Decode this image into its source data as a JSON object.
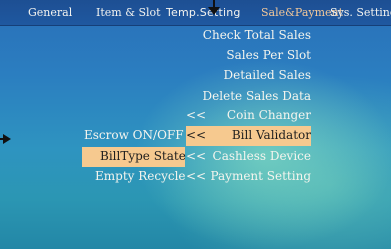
{
  "tabs": [
    {
      "label": "General"
    },
    {
      "label": "Item & Slot"
    },
    {
      "label": "Temp.Setting"
    },
    {
      "label": "Sale&Payment"
    },
    {
      "label": "Sys. Setting"
    }
  ],
  "menu": {
    "check_total_sales": "Check Total Sales",
    "sales_per_slot": "Sales Per Slot",
    "detailed_sales": "Detailed Sales",
    "delete_sales_data": "Delete Sales Data",
    "coin_changer": "Coin Changer",
    "bill_validator": "Bill Validator",
    "cashless_device": "Cashless Device",
    "payment_setting": "Payment Setting"
  },
  "submenu": {
    "escrow": "Escrow ON/OFF",
    "billtype_state": "BillType State",
    "empty_recycle": "Empty Recycle"
  },
  "arrow_glyph": "<<",
  "colors": {
    "active_tab": "#f2c89a",
    "highlight": "#f6c98f",
    "top_bar": "#1d4f93"
  }
}
